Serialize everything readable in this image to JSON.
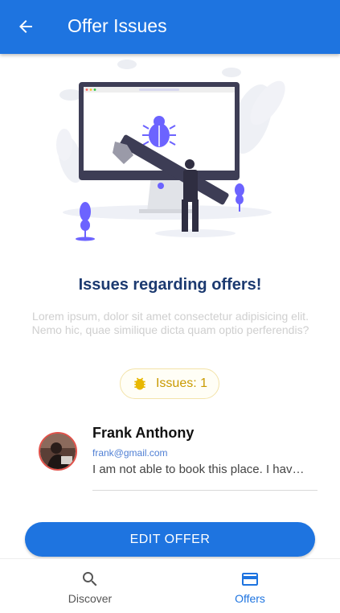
{
  "appbar": {
    "title": "Offer Issues",
    "back_icon": "arrow-left-icon"
  },
  "hero": {
    "headline": "Issues regarding offers!",
    "description": "Lorem ipsum, dolor sit amet consectetur adipisicing elit. Nemo hic, quae similique dicta quam optio perferendis?"
  },
  "issues_chip": {
    "label": "Issues: 1",
    "icon": "bug-icon",
    "color": "#c99a00"
  },
  "issue_item": {
    "name": "Frank Anthony",
    "email": "frank@gmail.com",
    "message": "I am not able to book this place. I have tried many times"
  },
  "action": {
    "edit_label": "EDIT OFFER"
  },
  "bottom_nav": {
    "items": [
      {
        "label": "Discover",
        "icon": "search-icon",
        "active": false
      },
      {
        "label": "Offers",
        "icon": "card-icon",
        "active": true
      }
    ]
  },
  "colors": {
    "primary": "#1e74e0",
    "headline": "#1c3a70",
    "accent_purple": "#6c63ff"
  }
}
